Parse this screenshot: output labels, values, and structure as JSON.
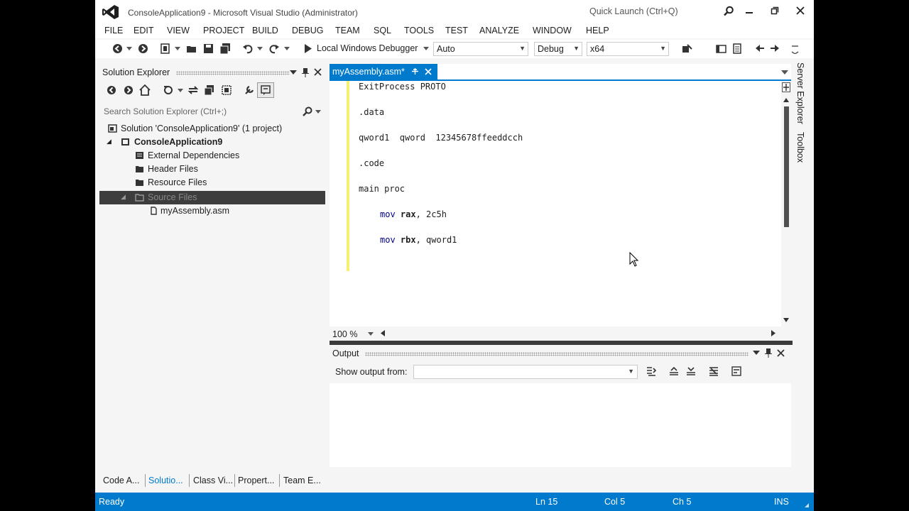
{
  "window": {
    "title": "ConsoleApplication9 - Microsoft Visual Studio (Administrator)",
    "quick_launch": "Quick Launch (Ctrl+Q)"
  },
  "menu": [
    "FILE",
    "EDIT",
    "VIEW",
    "PROJECT",
    "BUILD",
    "DEBUG",
    "TEAM",
    "SQL",
    "TOOLS",
    "TEST",
    "ANALYZE",
    "WINDOW",
    "HELP"
  ],
  "toolbar": {
    "start_debugger_label": "Local Windows Debugger",
    "solution_platform_value": "Auto",
    "configuration_value": "Debug",
    "platform_value": "x64"
  },
  "solution_explorer": {
    "title": "Solution Explorer",
    "search_placeholder": "Search Solution Explorer (Ctrl+;)",
    "tree": [
      {
        "label": "Solution 'ConsoleApplication9' (1 project)",
        "icon": "solution-icon"
      },
      {
        "label": "ConsoleApplication9",
        "icon": "project-icon",
        "bold": true
      },
      {
        "label": "External Dependencies",
        "icon": "dependencies-icon"
      },
      {
        "label": "Header Files",
        "icon": "folder-icon"
      },
      {
        "label": "Resource Files",
        "icon": "folder-icon"
      },
      {
        "label": "Source Files",
        "icon": "folder-icon",
        "selected": true
      },
      {
        "label": "myAssembly.asm",
        "icon": "file-icon"
      }
    ]
  },
  "editor": {
    "tab_label": "myAssembly.asm*",
    "zoom": "100 %",
    "code": {
      "l1": "ExitProcess PROTO",
      "l2": ".data",
      "l3": "qword1  qword  12345678ffeeddcch",
      "l4": ".code",
      "l5": "main proc",
      "l6_kw": "mov",
      "l6_reg": "rax",
      "l6_rest": ", 2c5h",
      "l7_kw": "mov",
      "l7_reg": "rbx",
      "l7_rest": ", qword1"
    }
  },
  "output": {
    "title": "Output",
    "show_from_label": "Show output from:",
    "show_from_value": ""
  },
  "right_tabs": [
    "Server Explorer",
    "Toolbox"
  ],
  "bottom_tabs": [
    "Code A...",
    "Solutio...",
    "Class Vi...",
    "Propert...",
    "Team E..."
  ],
  "status": {
    "state": "Ready",
    "line": "Ln 15",
    "col": "Col 5",
    "ch": "Ch 5",
    "mode": "INS"
  },
  "colors": {
    "accent": "#007acc",
    "changed_marker": "#f8ee6f",
    "selection": "#3d3d3d"
  }
}
